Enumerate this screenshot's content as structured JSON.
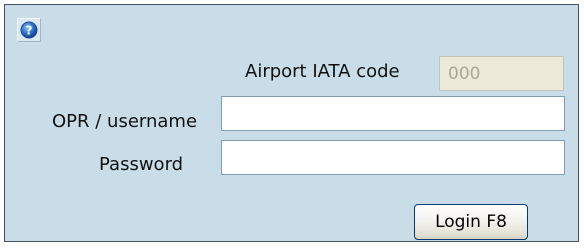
{
  "help": {
    "icon": "help-icon"
  },
  "airport": {
    "label": "Airport IATA code",
    "value": "000"
  },
  "username": {
    "label": "OPR / username",
    "value": ""
  },
  "password": {
    "label": "Password",
    "value": ""
  },
  "login": {
    "label": "Login F8"
  },
  "colors": {
    "panel_background": "#c9dde8",
    "help_icon_blue": "#2d6ec7"
  }
}
